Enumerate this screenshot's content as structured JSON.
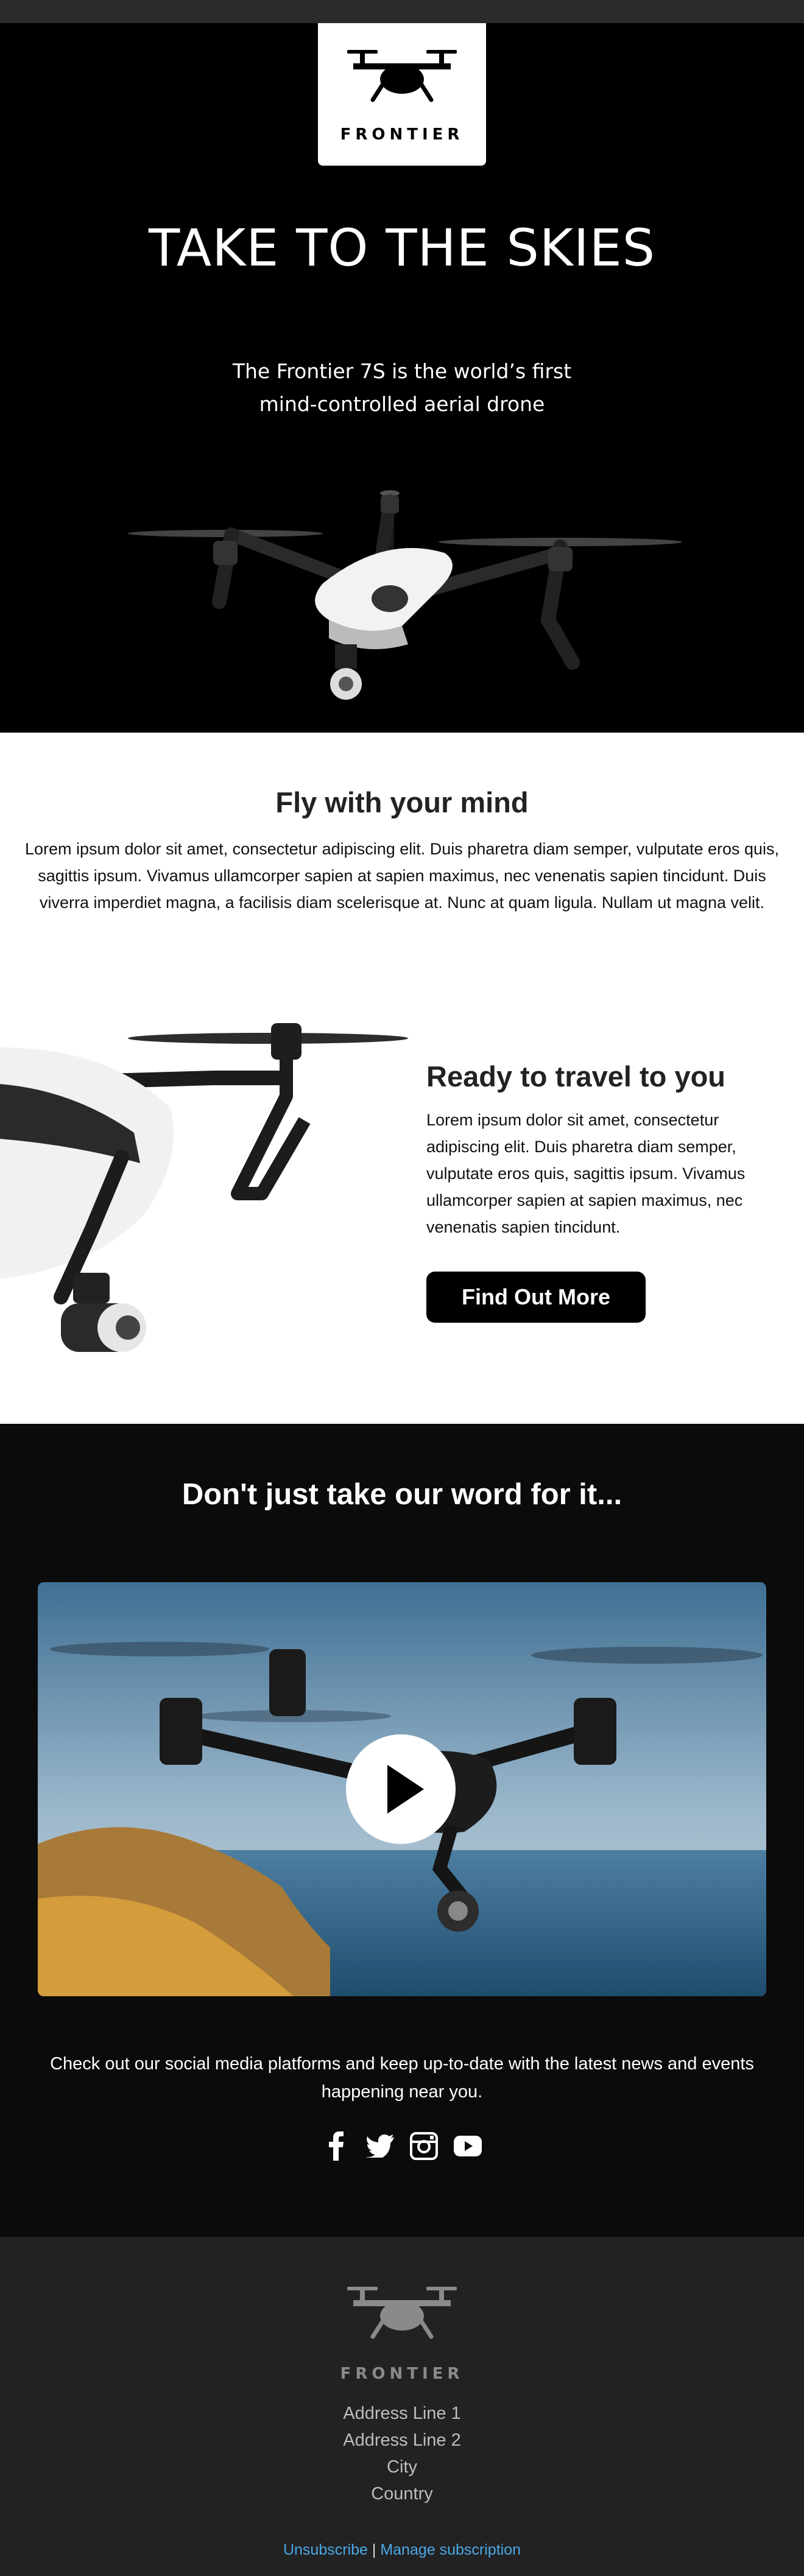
{
  "brand": {
    "name": "FRONTIER"
  },
  "hero": {
    "title": "TAKE TO THE SKIES",
    "subtitle_line1": "The Frontier 7S is the world’s first",
    "subtitle_line2": "mind-controlled aerial drone"
  },
  "fly": {
    "title": "Fly with your mind",
    "body": "Lorem ipsum dolor sit amet, consectetur adipiscing elit. Duis pharetra diam semper, vulputate eros quis, sagittis ipsum. Vivamus ullamcorper sapien at sapien maximus, nec venenatis sapien tincidunt. Duis viverra imperdiet magna, a facilisis diam scelerisque at. Nunc at quam ligula. Nullam ut magna velit."
  },
  "travel": {
    "title": "Ready to travel to you",
    "body": "Lorem ipsum dolor sit amet, consectetur adipiscing elit. Duis pharetra diam semper, vulputate eros quis, sagittis ipsum. Vivamus ullamcorper sapien at sapien maximus, nec venenatis sapien tincidunt.",
    "cta_label": "Find Out More"
  },
  "testimonials": {
    "title": "Don't just take our word for it...",
    "video_icon": "play-icon"
  },
  "social": {
    "text": "Check out our social media platforms and keep up-to-date with the latest news and events happening near you.",
    "icons": [
      "facebook-icon",
      "twitter-icon",
      "instagram-icon",
      "youtube-icon"
    ]
  },
  "footer": {
    "address": [
      "Address Line 1",
      "Address Line 2",
      "City",
      "Country"
    ],
    "unsubscribe": "Unsubscribe",
    "separator": "|",
    "manage": "Manage subscription"
  },
  "colors": {
    "hero_bg": "#000000",
    "dark_section_bg": "#0b0b0b",
    "footer_bg": "#222222",
    "link": "#4aa8e6",
    "cta_bg": "#000000"
  }
}
